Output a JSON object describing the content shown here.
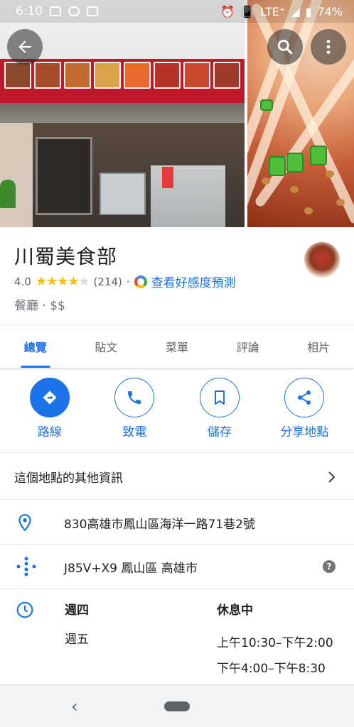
{
  "status_bar": {
    "time": "6:10",
    "network": "LTE⁺",
    "battery": "74%"
  },
  "header_buttons": {
    "back_icon": "arrow-back-icon",
    "search_icon": "search-icon",
    "more_icon": "more-vert-icon"
  },
  "place": {
    "name": "川蜀美食部",
    "rating": "4.0",
    "stars_filled": 4,
    "review_count": "(214)",
    "separator": "·",
    "predict_label": "查看好感度預測",
    "category": "餐廳 · $$"
  },
  "tabs": [
    {
      "label": "總覽",
      "active": true
    },
    {
      "label": "貼文",
      "active": false
    },
    {
      "label": "菜單",
      "active": false
    },
    {
      "label": "評論",
      "active": false
    },
    {
      "label": "相片",
      "active": false
    }
  ],
  "actions": [
    {
      "label": "路線",
      "icon": "directions-icon"
    },
    {
      "label": "致電",
      "icon": "phone-icon"
    },
    {
      "label": "儲存",
      "icon": "bookmark-icon"
    },
    {
      "label": "分享地點",
      "icon": "share-icon"
    }
  ],
  "more_info": {
    "label": "這個地點的其他資訊"
  },
  "address": "830高雄市鳳山區海洋一路71巷2號",
  "plus_code": "J85V+X9 鳳山區 高雄市",
  "hours": {
    "day_today": "週四",
    "status_today": "休息中",
    "day_next": "週五",
    "times_next": [
      "上午10:30–下午2:00",
      "下午4:00–下午8:30"
    ]
  },
  "colors": {
    "accent": "#1a73e8",
    "star": "#fbbc04"
  }
}
